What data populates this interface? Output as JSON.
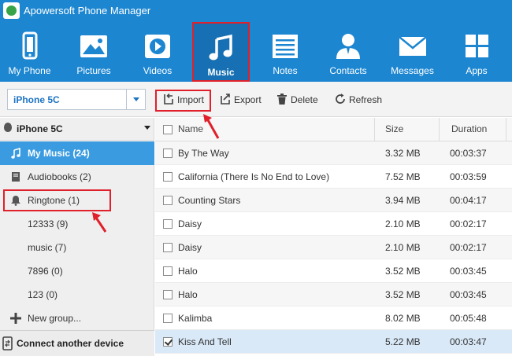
{
  "app": {
    "title": "Apowersoft Phone Manager"
  },
  "nav": [
    {
      "label": "My Phone",
      "icon": "phone-icon"
    },
    {
      "label": "Pictures",
      "icon": "picture-icon"
    },
    {
      "label": "Videos",
      "icon": "video-icon"
    },
    {
      "label": "Music",
      "icon": "music-note-icon",
      "active": true
    },
    {
      "label": "Notes",
      "icon": "notes-icon"
    },
    {
      "label": "Contacts",
      "icon": "contacts-icon"
    },
    {
      "label": "Messages",
      "icon": "envelope-icon"
    },
    {
      "label": "Apps",
      "icon": "apps-grid-icon"
    }
  ],
  "toolbar": {
    "device_value": "iPhone 5C",
    "import_label": "Import",
    "export_label": "Export",
    "delete_label": "Delete",
    "refresh_label": "Refresh"
  },
  "sidebar": {
    "device_name": "iPhone 5C",
    "items": [
      {
        "label": "My Music (24)",
        "icon": "music-note-icon",
        "active": true
      },
      {
        "label": "Audiobooks (2)",
        "icon": "book-icon"
      },
      {
        "label": "Ringtone (1)",
        "icon": "bell-icon"
      },
      {
        "label": "12333 (9)"
      },
      {
        "label": "music (7)"
      },
      {
        "label": "7896 (0)"
      },
      {
        "label": "123 (0)"
      },
      {
        "label": "New group...",
        "icon": "plus-icon"
      }
    ],
    "footer_label": "Connect another device"
  },
  "table": {
    "columns": {
      "name": "Name",
      "size": "Size",
      "duration": "Duration"
    },
    "rows": [
      {
        "name": "By The Way",
        "size": "3.32 MB",
        "duration": "00:03:37",
        "checked": false
      },
      {
        "name": "California (There Is No End to Love)",
        "size": "7.52 MB",
        "duration": "00:03:59",
        "checked": false
      },
      {
        "name": "Counting Stars",
        "size": "3.94 MB",
        "duration": "00:04:17",
        "checked": false
      },
      {
        "name": "Daisy",
        "size": "2.10 MB",
        "duration": "00:02:17",
        "checked": false
      },
      {
        "name": "Daisy",
        "size": "2.10 MB",
        "duration": "00:02:17",
        "checked": false
      },
      {
        "name": "Halo",
        "size": "3.52 MB",
        "duration": "00:03:45",
        "checked": false
      },
      {
        "name": "Halo",
        "size": "3.52 MB",
        "duration": "00:03:45",
        "checked": false
      },
      {
        "name": "Kalimba",
        "size": "8.02 MB",
        "duration": "00:05:48",
        "checked": false
      },
      {
        "name": "Kiss And Tell",
        "size": "5.22 MB",
        "duration": "00:03:47",
        "checked": true
      }
    ]
  },
  "colors": {
    "brand": "#1c86d1",
    "active_nav": "#1670b3",
    "highlight": "#e0202a",
    "sidebar_active": "#3a9be0"
  }
}
